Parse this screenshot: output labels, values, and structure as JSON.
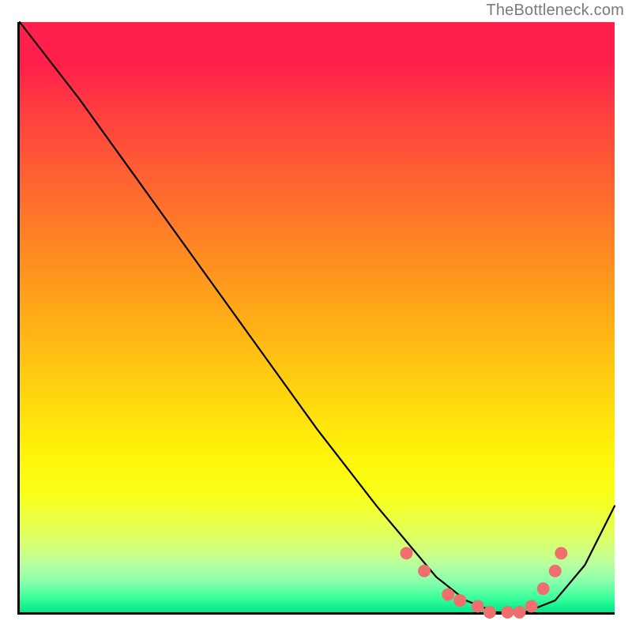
{
  "attribution": "TheBottleneck.com",
  "chart_data": {
    "type": "line",
    "title": "",
    "xlabel": "",
    "ylabel": "",
    "xlim": [
      0,
      100
    ],
    "ylim": [
      0,
      100
    ],
    "grid": false,
    "legend": false,
    "series": [
      {
        "name": "curve",
        "x": [
          0,
          10,
          20,
          30,
          40,
          50,
          60,
          65,
          70,
          75,
          80,
          85,
          90,
          95,
          100
        ],
        "y": [
          100,
          87,
          73,
          59,
          45,
          31,
          18,
          12,
          6,
          2,
          0,
          0,
          2,
          8,
          18
        ]
      }
    ],
    "markers": {
      "name": "dots",
      "x": [
        65,
        68,
        72,
        74,
        77,
        79,
        82,
        84,
        86,
        88,
        90,
        91
      ],
      "y": [
        10,
        7,
        3,
        2,
        1,
        0,
        0,
        0,
        1,
        4,
        7,
        10
      ]
    },
    "background": {
      "type": "vertical-gradient",
      "stops": [
        {
          "pos": 0.0,
          "color": "#ff1f4a"
        },
        {
          "pos": 0.5,
          "color": "#ffb914"
        },
        {
          "pos": 0.8,
          "color": "#f9ff18"
        },
        {
          "pos": 1.0,
          "color": "#00e88a"
        }
      ]
    }
  }
}
